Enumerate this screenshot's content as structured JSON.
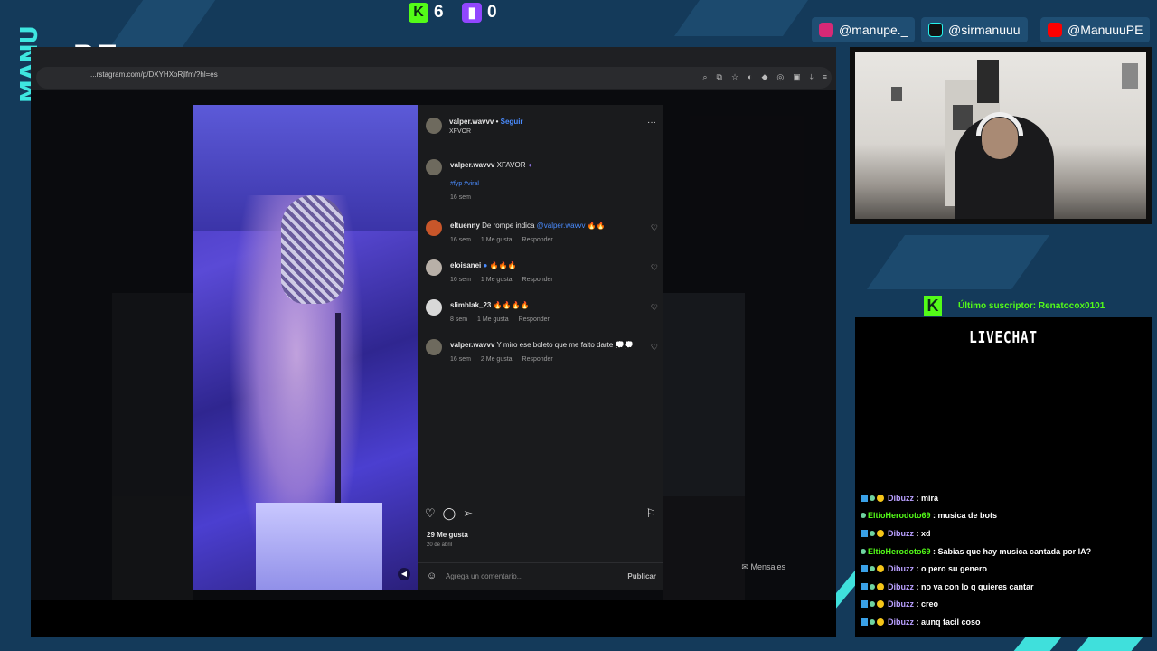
{
  "overlay": {
    "logo_left": "MANU",
    "logo_right": "PE",
    "kick_count": "6",
    "twitch_count": "0",
    "socials": [
      {
        "label": "@manupe._",
        "icon": "instagram-icon",
        "color": "#d62976"
      },
      {
        "label": "@sirmanuuu",
        "icon": "tiktok-icon",
        "color": "#111111"
      },
      {
        "label": "@ManuuuPE",
        "icon": "youtube-icon",
        "color": "#ff0000"
      }
    ],
    "last_subscriber": "Último suscriptor: Renatocox0101",
    "chat_title": "LIVECHAT"
  },
  "browser": {
    "url": "instagram.com/p/DXYHXoRjlfm/?hl=es",
    "url_partial": "...rstagram.com/p/DXYHXoRjlfm/?hl=es"
  },
  "post": {
    "author": "valper.wavvv",
    "follow_label": "Seguir",
    "subtitle": "XFVOR",
    "caption_user": "valper.wavvv",
    "caption_text": "XFAVOR",
    "caption_tags": "#fyp #viral",
    "caption_time": "16 sem",
    "comments": [
      {
        "user": "eltuenny",
        "text": "De rompe indica ",
        "mention": "@valper.wavvv",
        "emoji": " 🔥🔥",
        "time": "16 sem",
        "likes": "1 Me gusta",
        "reply": "Responder"
      },
      {
        "user": "eloisanei",
        "text": " 🔥🔥🔥",
        "mention": "",
        "emoji": "",
        "time": "16 sem",
        "likes": "1 Me gusta",
        "reply": "Responder"
      },
      {
        "user": "slimblak_23",
        "text": " 🔥🔥🔥🔥",
        "mention": "",
        "emoji": "",
        "time": "8 sem",
        "likes": "1 Me gusta",
        "reply": "Responder"
      },
      {
        "user": "valper.wavvv",
        "text": " Y miro ese boleto que me falto darte ",
        "mention": "",
        "emoji": "💭💭",
        "time": "16 sem",
        "likes": "2 Me gusta",
        "reply": "Responder"
      }
    ],
    "likes_total": "29 Me gusta",
    "date": "20 de abril",
    "comment_placeholder": "Agrega un comentario...",
    "publish_label": "Publicar",
    "messages_label": "Mensajes"
  },
  "chat": [
    {
      "user": "Dibuzz",
      "text": "mira",
      "color": "#b9a0ff"
    },
    {
      "user": "EltioHerodoto69",
      "text": "musica de bots",
      "color": "#53fc18"
    },
    {
      "user": "Dibuzz",
      "text": "xd",
      "color": "#b9a0ff"
    },
    {
      "user": "EltioHerodoto69",
      "text": "Sabias que hay musica cantada por IA?",
      "color": "#53fc18"
    },
    {
      "user": "Dibuzz",
      "text": "o pero su genero",
      "color": "#b9a0ff"
    },
    {
      "user": "Dibuzz",
      "text": "no va con lo q quieres cantar",
      "color": "#b9a0ff"
    },
    {
      "user": "Dibuzz",
      "text": "creo",
      "color": "#b9a0ff"
    },
    {
      "user": "Dibuzz",
      "text": "aunq facil coso",
      "color": "#b9a0ff"
    }
  ]
}
